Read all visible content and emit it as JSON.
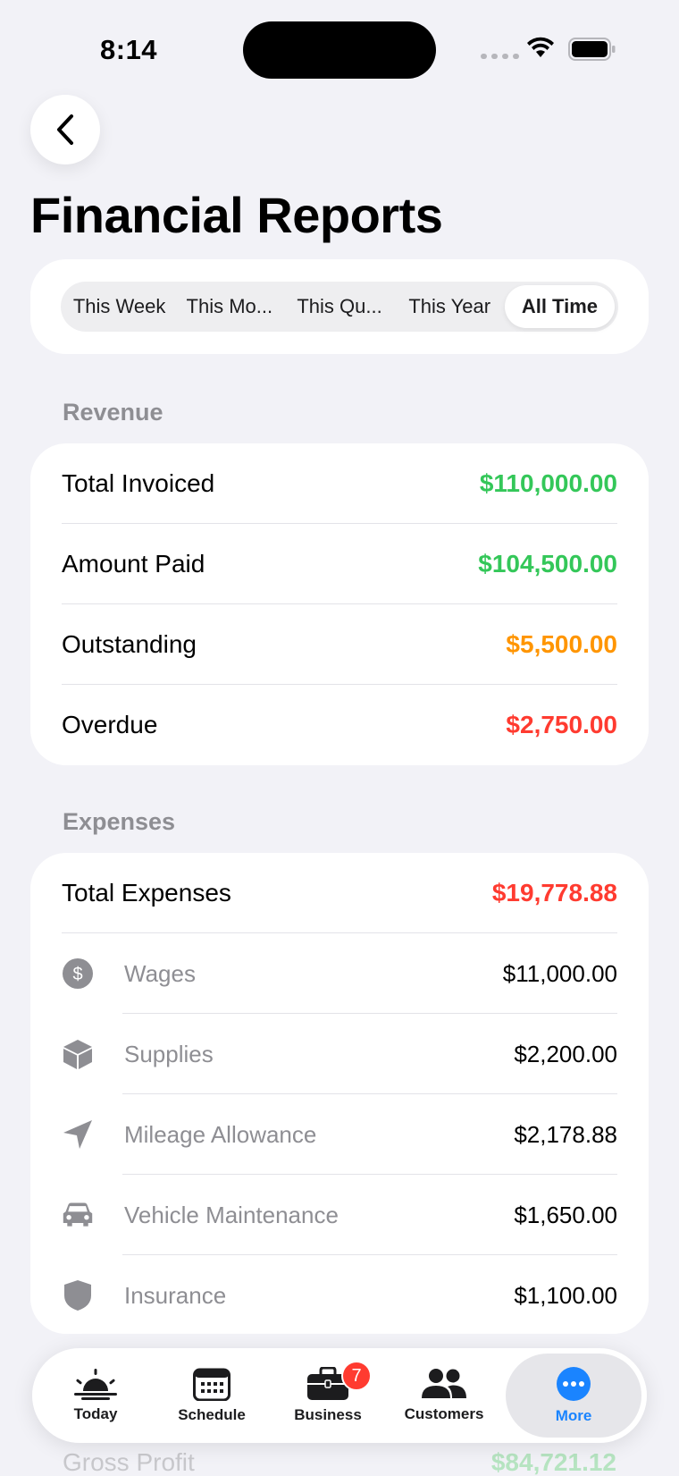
{
  "status": {
    "time": "8:14"
  },
  "header": {
    "title": "Financial Reports"
  },
  "period_tabs": [
    {
      "label": "This Week"
    },
    {
      "label": "This Mo..."
    },
    {
      "label": "This Qu..."
    },
    {
      "label": "This Year"
    },
    {
      "label": "All Time"
    }
  ],
  "selected_period": "All Time",
  "revenue": {
    "header": "Revenue",
    "rows": [
      {
        "label": "Total Invoiced",
        "value": "$110,000.00",
        "color": "#34c759"
      },
      {
        "label": "Amount Paid",
        "value": "$104,500.00",
        "color": "#34c759"
      },
      {
        "label": "Outstanding",
        "value": "$5,500.00",
        "color": "#ff9500"
      },
      {
        "label": "Overdue",
        "value": "$2,750.00",
        "color": "#ff3b30"
      }
    ]
  },
  "expenses": {
    "header": "Expenses",
    "total_label": "Total Expenses",
    "total_value": "$19,778.88",
    "total_color": "#ff3b30",
    "items": [
      {
        "icon": "dollar-circle-icon",
        "label": "Wages",
        "value": "$11,000.00"
      },
      {
        "icon": "box-icon",
        "label": "Supplies",
        "value": "$2,200.00"
      },
      {
        "icon": "location-arrow-icon",
        "label": "Mileage Allowance",
        "value": "$2,178.88"
      },
      {
        "icon": "car-icon",
        "label": "Vehicle Maintenance",
        "value": "$1,650.00"
      },
      {
        "icon": "shield-icon",
        "label": "Insurance",
        "value": "$1,100.00"
      }
    ]
  },
  "profit": {
    "label": "Gross Profit",
    "value": "$84,721.12"
  },
  "tab_bar": {
    "tabs": [
      {
        "label": "Today",
        "icon": "sunrise-icon"
      },
      {
        "label": "Schedule",
        "icon": "calendar-icon"
      },
      {
        "label": "Business",
        "icon": "briefcase-icon",
        "badge": "7"
      },
      {
        "label": "Customers",
        "icon": "people-icon"
      },
      {
        "label": "More",
        "icon": "ellipsis-circle-icon"
      }
    ],
    "active": "More",
    "accent": "#1a84ff"
  }
}
